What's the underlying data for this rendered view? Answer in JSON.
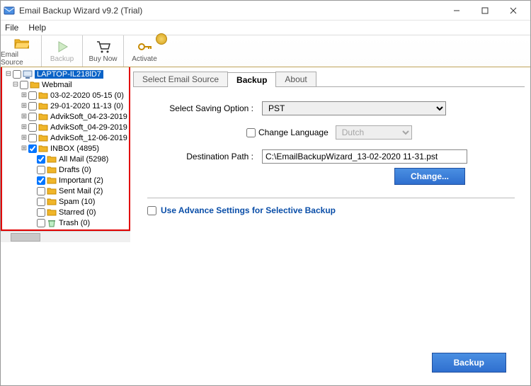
{
  "titlebar": {
    "title": "Email Backup Wizard v9.2 (Trial)"
  },
  "menubar": {
    "file": "File",
    "help": "Help"
  },
  "toolbar": {
    "email_source": "Email Source",
    "backup": "Backup",
    "buy_now": "Buy Now",
    "activate": "Activate"
  },
  "tree": {
    "root": "LAPTOP-IL218lD7",
    "webmail": "Webmail",
    "items": [
      {
        "label": "03-02-2020 05-15 (0)",
        "expandable": true,
        "checked": false
      },
      {
        "label": "29-01-2020 11-13 (0)",
        "expandable": true,
        "checked": false
      },
      {
        "label": "AdvikSoft_04-23-2019",
        "expandable": true,
        "checked": false
      },
      {
        "label": "AdvikSoft_04-29-2019",
        "expandable": true,
        "checked": false
      },
      {
        "label": "AdvikSoft_12-06-2019",
        "expandable": true,
        "checked": false
      },
      {
        "label": "INBOX (4895)",
        "expandable": true,
        "checked": true
      },
      {
        "label": "All Mail (5298)",
        "expandable": false,
        "checked": true
      },
      {
        "label": "Drafts (0)",
        "expandable": false,
        "checked": false
      },
      {
        "label": "Important (2)",
        "expandable": false,
        "checked": true
      },
      {
        "label": "Sent Mail (2)",
        "expandable": false,
        "checked": false
      },
      {
        "label": "Spam (10)",
        "expandable": false,
        "checked": false
      },
      {
        "label": "Starred (0)",
        "expandable": false,
        "checked": false
      },
      {
        "label": "Trash (0)",
        "expandable": false,
        "checked": false
      }
    ]
  },
  "tabs": {
    "select_source": "Select Email Source",
    "backup": "Backup",
    "about": "About"
  },
  "panel": {
    "saving_option_label": "Select Saving Option :",
    "saving_option_value": "PST",
    "change_language_label": "Change Language",
    "language_value": "Dutch",
    "destination_label": "Destination Path :",
    "destination_value": "C:\\EmailBackupWizard_13-02-2020 11-31.pst",
    "change_btn": "Change...",
    "advance_label": "Use Advance Settings for Selective Backup",
    "backup_btn": "Backup"
  },
  "icons": {
    "folder_color": "#f0b62a",
    "folder_stroke": "#c78a00"
  }
}
